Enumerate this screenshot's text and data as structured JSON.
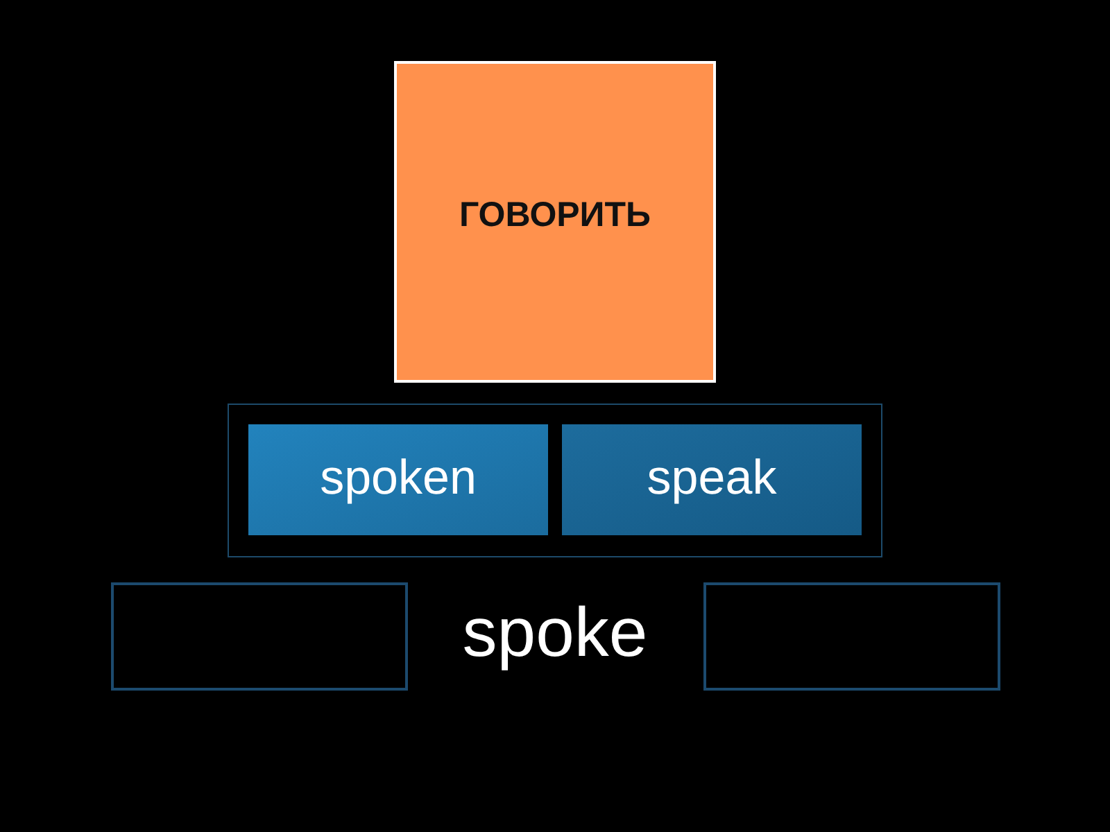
{
  "card": {
    "text": "ГОВОРИТЬ"
  },
  "tiles": [
    {
      "text": "spoken"
    },
    {
      "text": "speak"
    }
  ],
  "answer_row": [
    {
      "kind": "blank"
    },
    {
      "kind": "word",
      "text": "spoke"
    },
    {
      "kind": "blank"
    }
  ]
}
